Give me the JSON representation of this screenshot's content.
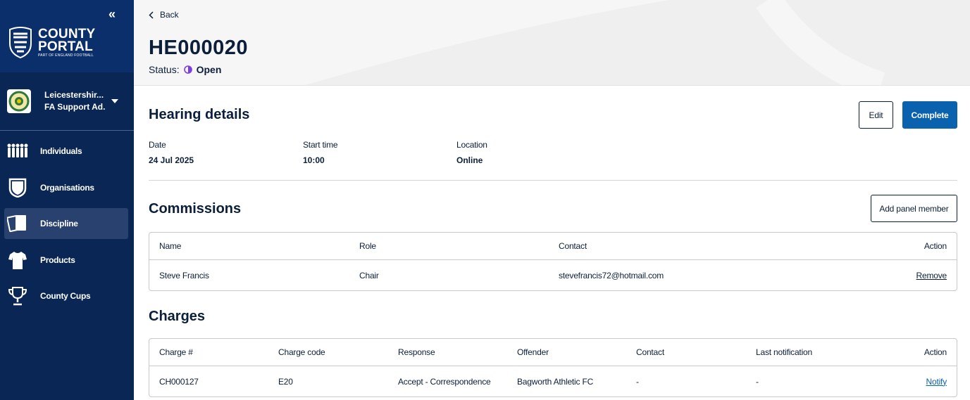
{
  "sidebar": {
    "collapse_label": "«",
    "logo": {
      "line1": "COUNTY",
      "line2": "PORTAL",
      "tagline": "PART OF ENGLAND FOOTBALL"
    },
    "account": {
      "org": "Leicestershir...",
      "role": "FA Support Ad..."
    },
    "items": [
      {
        "label": "Individuals",
        "icon": "people-group-icon"
      },
      {
        "label": "Organisations",
        "icon": "shield-icon"
      },
      {
        "label": "Discipline",
        "icon": "cards-icon",
        "active": true
      },
      {
        "label": "Products",
        "icon": "shirt-icon"
      },
      {
        "label": "County Cups",
        "icon": "trophy-icon"
      }
    ]
  },
  "header": {
    "back_label": "Back",
    "title": "HE000020",
    "status_label": "Status:",
    "status_value": "Open"
  },
  "hearing": {
    "title": "Hearing details",
    "edit_label": "Edit",
    "complete_label": "Complete",
    "date_label": "Date",
    "date_value": "24 Jul 2025",
    "start_label": "Start time",
    "start_value": "10:00",
    "location_label": "Location",
    "location_value": "Online"
  },
  "commissions": {
    "title": "Commissions",
    "add_label": "Add panel member",
    "columns": [
      "Name",
      "Role",
      "Contact",
      "Action"
    ],
    "rows": [
      {
        "name": "Steve Francis",
        "role": "Chair",
        "contact": "stevefrancis72@hotmail.com",
        "action": "Remove"
      }
    ]
  },
  "charges": {
    "title": "Charges",
    "columns": [
      "Charge #",
      "Charge code",
      "Response",
      "Offender",
      "Contact",
      "Last notification",
      "Action"
    ],
    "rows": [
      {
        "charge": "CH000127",
        "code": "E20",
        "response": "Accept - Correspondence",
        "offender": "Bagworth Athletic FC",
        "contact": "-",
        "last": "-",
        "action": "Notify"
      }
    ]
  },
  "colors": {
    "sidebar_bg": "#0a2654",
    "primary": "#0a61ae",
    "status_open": "#7b3fe4"
  }
}
